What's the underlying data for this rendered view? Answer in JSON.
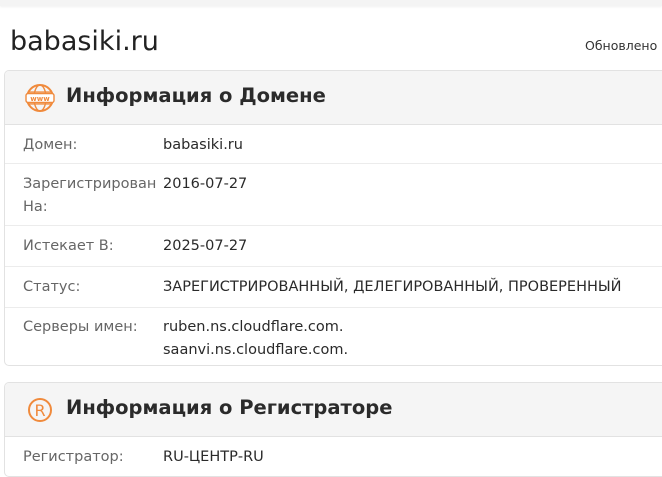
{
  "header": {
    "domain": "babasiki.ru",
    "updated_label": "Обновлено"
  },
  "domain_info": {
    "title": "Информация о Домене",
    "icon": "www-icon",
    "rows": [
      {
        "label": "Домен:",
        "value": "babasiki.ru"
      },
      {
        "label": "Зарегистрирован На:",
        "value": "2016-07-27"
      },
      {
        "label": "Истекает В:",
        "value": "2025-07-27"
      },
      {
        "label": "Статус:",
        "value": "ЗАРЕГИСТРИРОВАННЫЙ, ДЕЛЕГИРОВАННЫЙ, ПРОВЕРЕННЫЙ"
      },
      {
        "label": "Серверы имен:",
        "values": [
          "ruben.ns.cloudflare.com.",
          "saanvi.ns.cloudflare.com."
        ]
      }
    ]
  },
  "registrar_info": {
    "title": "Информация о Регистраторе",
    "icon": "registered-icon",
    "rows": [
      {
        "label": "Регистратор:",
        "value": "RU-ЦЕНТР-RU"
      }
    ]
  },
  "colors": {
    "accent": "#f08a3c",
    "panel_header_bg": "#f5f5f5",
    "border": "#e2e2e2"
  }
}
